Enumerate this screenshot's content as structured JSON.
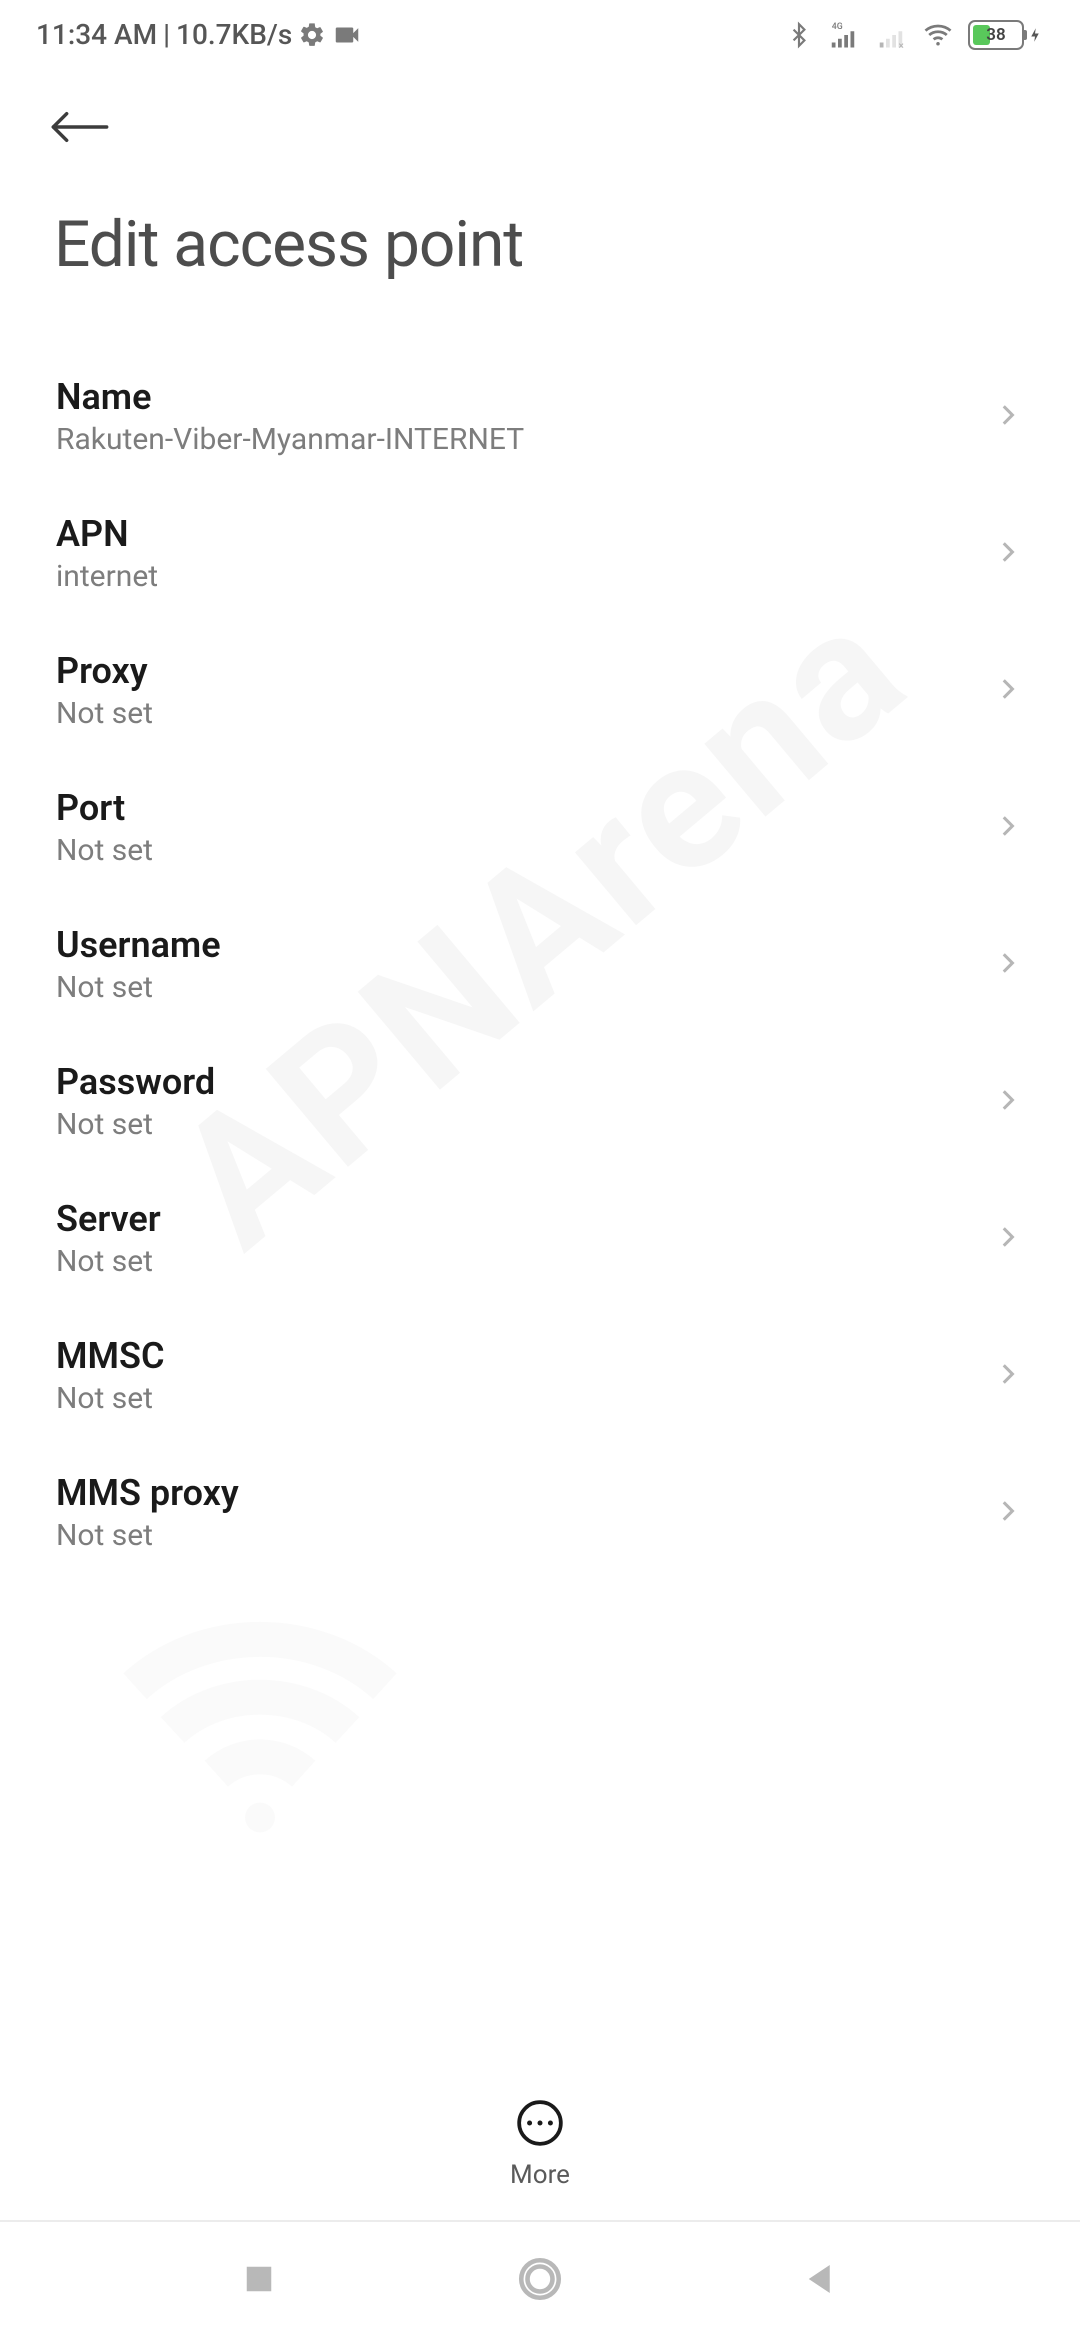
{
  "status_bar": {
    "time": "11:34 AM",
    "separator": "|",
    "speed": "10.7KB/s",
    "battery_pct": "38"
  },
  "back_label": "Back",
  "page_title": "Edit access point",
  "settings": [
    {
      "label": "Name",
      "value": "Rakuten-Viber-Myanmar-INTERNET"
    },
    {
      "label": "APN",
      "value": "internet"
    },
    {
      "label": "Proxy",
      "value": "Not set"
    },
    {
      "label": "Port",
      "value": "Not set"
    },
    {
      "label": "Username",
      "value": "Not set"
    },
    {
      "label": "Password",
      "value": "Not set"
    },
    {
      "label": "Server",
      "value": "Not set"
    },
    {
      "label": "MMSC",
      "value": "Not set"
    },
    {
      "label": "MMS proxy",
      "value": "Not set"
    }
  ],
  "bottom_action": {
    "label": "More"
  },
  "watermark": "APNArena"
}
